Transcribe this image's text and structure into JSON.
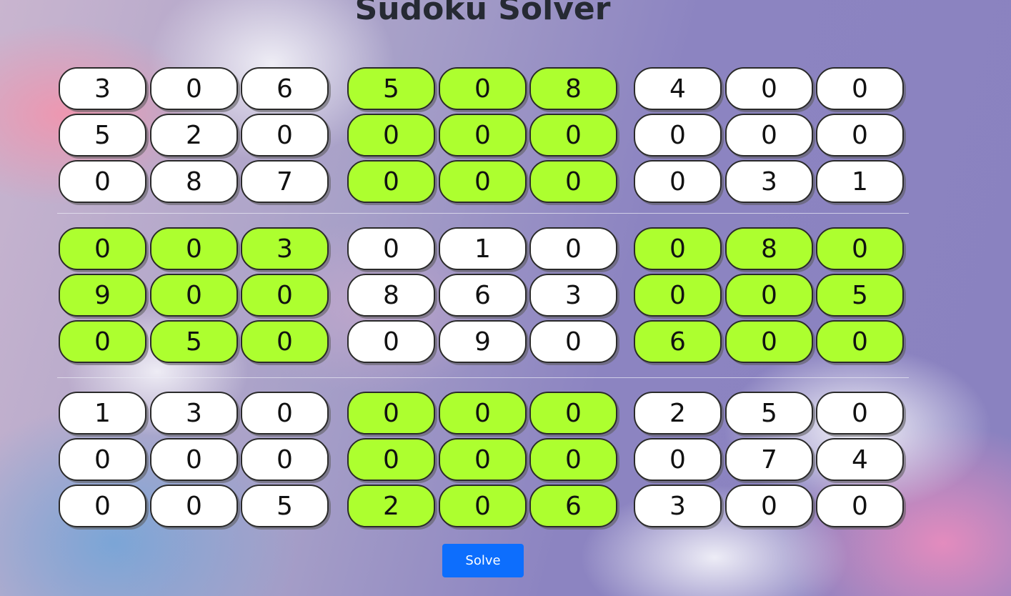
{
  "title": "Sudoku Solver",
  "solve_label": "Solve",
  "colors": {
    "highlight": "#adff2f",
    "plain": "#ffffff",
    "button": "#0d6efd"
  },
  "grid": [
    [
      "3",
      "0",
      "6",
      "5",
      "0",
      "8",
      "4",
      "0",
      "0"
    ],
    [
      "5",
      "2",
      "0",
      "0",
      "0",
      "0",
      "0",
      "0",
      "0"
    ],
    [
      "0",
      "8",
      "7",
      "0",
      "0",
      "0",
      "0",
      "3",
      "1"
    ],
    [
      "0",
      "0",
      "3",
      "0",
      "1",
      "0",
      "0",
      "8",
      "0"
    ],
    [
      "9",
      "0",
      "0",
      "8",
      "6",
      "3",
      "0",
      "0",
      "5"
    ],
    [
      "0",
      "5",
      "0",
      "0",
      "9",
      "0",
      "6",
      "0",
      "0"
    ],
    [
      "1",
      "3",
      "0",
      "0",
      "0",
      "0",
      "2",
      "5",
      "0"
    ],
    [
      "0",
      "0",
      "0",
      "0",
      "0",
      "0",
      "0",
      "7",
      "4"
    ],
    [
      "0",
      "0",
      "5",
      "2",
      "0",
      "6",
      "3",
      "0",
      "0"
    ]
  ]
}
